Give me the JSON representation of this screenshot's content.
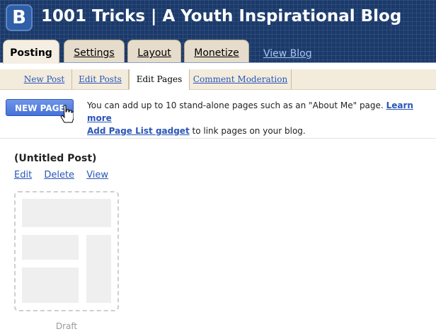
{
  "header": {
    "logo_letter": "B",
    "blog_title": "1001 Tricks | A Youth Inspirational Blog",
    "tabs": [
      {
        "label": "Posting"
      },
      {
        "label": "Settings"
      },
      {
        "label": "Layout"
      },
      {
        "label": "Monetize"
      }
    ],
    "view_blog_label": "View Blog"
  },
  "subnav": {
    "items": [
      {
        "label": "New Post"
      },
      {
        "label": "Edit Posts"
      },
      {
        "label": "Edit Pages"
      },
      {
        "label": "Comment Moderation"
      }
    ]
  },
  "actions": {
    "new_page_label": "NEW PAGE"
  },
  "info": {
    "text_1": "You can add up to 10 stand-alone pages such as an \"About Me\" page.",
    "learn_more": "Learn more",
    "gadget_link": "Add Page List gadget",
    "text_2": "to link pages on your blog."
  },
  "post": {
    "title": "(Untitled Post)",
    "edit_label": "Edit",
    "delete_label": "Delete",
    "view_label": "View",
    "status": "Draft"
  },
  "colors": {
    "header_bg": "#1b3a6b",
    "link": "#2a56b8",
    "button": "#4571d8"
  }
}
